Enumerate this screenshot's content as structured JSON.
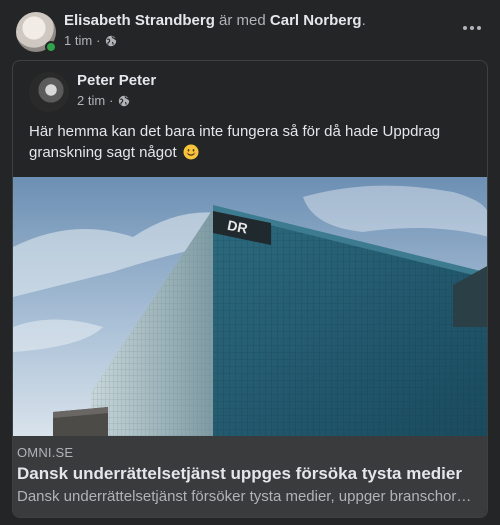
{
  "post": {
    "author": "Elisabeth Strandberg",
    "with_text": "är med",
    "tagged": "Carl Norberg",
    "period": ".",
    "time": "1 tim",
    "separator": "·"
  },
  "shared": {
    "author": "Peter Peter",
    "time": "2 tim",
    "separator": "·",
    "text": "Här hemma kan det bara inte fungera så för då hade Uppdrag granskning sagt något"
  },
  "link": {
    "domain": "OMNI.SE",
    "title": "Dansk underrättelsetjänst uppges försöka tysta medier",
    "description": "Dansk underrättelsetjänst försöker tysta medier, uppger branschor…",
    "image_sign_text": "DR"
  },
  "icons": {
    "privacy": "globe-icon",
    "menu": "more-options-icon",
    "emoji": "smiling-face-emoji"
  },
  "colors": {
    "background": "#242526",
    "text_primary": "#e4e6eb",
    "text_secondary": "#b0b3b8",
    "link_meta_bg": "#3a3b3c",
    "online_dot": "#31a24c"
  }
}
